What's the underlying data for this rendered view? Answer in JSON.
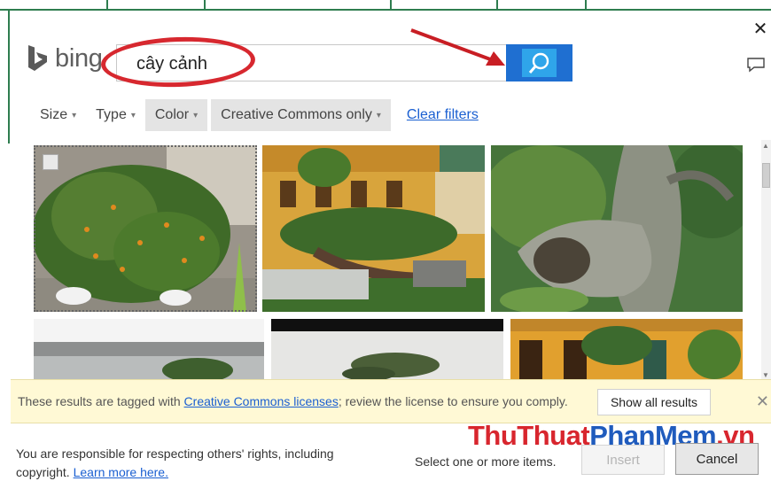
{
  "window": {
    "close_glyph": "✕"
  },
  "brand": {
    "name": "bing",
    "accent": "#1f6fd1"
  },
  "search": {
    "value": "cây cảnh",
    "button_icon": "search-icon"
  },
  "filters": {
    "items": [
      {
        "label": "Size",
        "active": false
      },
      {
        "label": "Type",
        "active": false
      },
      {
        "label": "Color",
        "active": true
      },
      {
        "label": "Creative Commons only",
        "active": true
      }
    ],
    "caret": "▾",
    "clear_label": "Clear filters"
  },
  "results": {
    "images": [
      {
        "name": "kumquat-bonsai-courtyard",
        "selected": true
      },
      {
        "name": "bonsai-yellow-building",
        "selected": false
      },
      {
        "name": "mossy-tree-trunk",
        "selected": false
      },
      {
        "name": "bonsai-grey-roof",
        "selected": false
      },
      {
        "name": "bonsai-dark-background",
        "selected": false
      },
      {
        "name": "yellow-building-palm",
        "selected": false
      }
    ]
  },
  "notice": {
    "text_before": "These results are tagged with ",
    "link": "Creative Commons licenses",
    "text_after": "; review the license to ensure you comply.",
    "show_all_label": "Show all results",
    "close_glyph": "✕"
  },
  "footer": {
    "disclaimer": "You are responsible for respecting others' rights, including copyright.",
    "learn_more": "Learn more here.",
    "select_hint": "Select one or more items.",
    "insert_label": "Insert",
    "cancel_label": "Cancel"
  },
  "watermark": {
    "part1": "ThuThuat",
    "part2": "PhanMem",
    "part3": ".vn"
  }
}
